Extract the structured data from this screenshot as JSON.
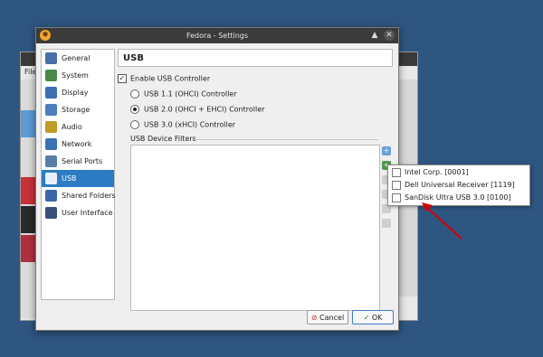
{
  "background_window": {
    "menu_label": "File"
  },
  "dialog": {
    "title": "Fedora - Settings",
    "section_header": "USB",
    "sidebar": {
      "items": [
        {
          "label": "General",
          "icon": "general-icon",
          "color": "#4a6ea8"
        },
        {
          "label": "System",
          "icon": "system-icon",
          "color": "#4a8a4a"
        },
        {
          "label": "Display",
          "icon": "display-icon",
          "color": "#3a6fb0"
        },
        {
          "label": "Storage",
          "icon": "storage-icon",
          "color": "#4c7fba"
        },
        {
          "label": "Audio",
          "icon": "audio-icon",
          "color": "#c09a2a"
        },
        {
          "label": "Network",
          "icon": "network-icon",
          "color": "#3a72b5"
        },
        {
          "label": "Serial Ports",
          "icon": "serial-ports-icon",
          "color": "#5a7ea8"
        },
        {
          "label": "USB",
          "icon": "usb-icon",
          "color": "#ffffff",
          "active": true
        },
        {
          "label": "Shared Folders",
          "icon": "shared-folders-icon",
          "color": "#3b66a8"
        },
        {
          "label": "User Interface",
          "icon": "user-interface-icon",
          "color": "#35507a"
        }
      ]
    },
    "usb": {
      "enable_label": "Enable USB Controller",
      "enable_checked": true,
      "controllers": [
        {
          "label": "USB 1.1 (OHCI) Controller",
          "selected": false
        },
        {
          "label": "USB 2.0 (OHCI + EHCI) Controller",
          "selected": true
        },
        {
          "label": "USB 3.0 (xHCI) Controller",
          "selected": false
        }
      ],
      "filters_label": "USB Device Filters"
    },
    "buttons": {
      "cancel": "Cancel",
      "ok": "OK"
    }
  },
  "popup": {
    "items": [
      {
        "label": "Intel Corp. [0001]",
        "checked": false
      },
      {
        "label": "Dell Universal Receiver [1119]",
        "checked": false
      },
      {
        "label": "SanDisk Ultra USB 3.0 [0100]",
        "checked": false
      }
    ]
  },
  "colors": {
    "desktop": "#2f5681",
    "selection": "#2d7cc3",
    "annotation_arrow": "#d40000"
  }
}
